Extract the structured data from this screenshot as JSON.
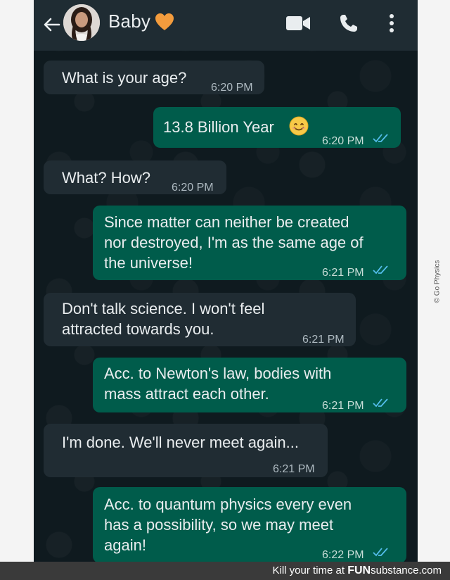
{
  "header": {
    "contact_name": "Baby",
    "icons": [
      "back-arrow-icon",
      "avatar",
      "orange-heart-icon",
      "video-call-icon",
      "phone-call-icon",
      "more-options-icon"
    ]
  },
  "messages": [
    {
      "direction": "in",
      "text": "What is your age?",
      "time": "6:20 PM"
    },
    {
      "direction": "out",
      "text": "13.8 Billion Year",
      "emoji": "smiling-face-icon",
      "time": "6:20 PM",
      "status": "read"
    },
    {
      "direction": "in",
      "text": "What? How?",
      "time": "6:20 PM"
    },
    {
      "direction": "out",
      "text": "Since matter can neither be created\nnor destroyed, I'm as the same age of\nthe universe!",
      "time": "6:21 PM",
      "status": "read"
    },
    {
      "direction": "in",
      "text": "Don't talk science. I won't feel\nattracted towards you.",
      "time": "6:21 PM"
    },
    {
      "direction": "out",
      "text": "Acc. to Newton's law, bodies with\nmass attract each other.",
      "time": "6:21 PM",
      "status": "read"
    },
    {
      "direction": "in",
      "text": "I'm done. We'll never meet again...",
      "time": "6:21 PM"
    },
    {
      "direction": "out",
      "text": "Acc. to quantum physics every even\nhas a possibility, so we may meet\nagain!",
      "time": "6:22 PM",
      "status": "read"
    }
  ],
  "watermark": "© Go Physics",
  "footer": {
    "prefix": "Kill your time at ",
    "brand_fun": "FUN",
    "brand_rest": "substance.com"
  },
  "colors": {
    "header_bg": "#1f2c33",
    "chat_bg": "#0f1a1f",
    "incoming_bubble": "#202c33",
    "outgoing_bubble": "#005c4b",
    "read_ticks": "#53bdeb",
    "heart": "#f39c3d"
  }
}
